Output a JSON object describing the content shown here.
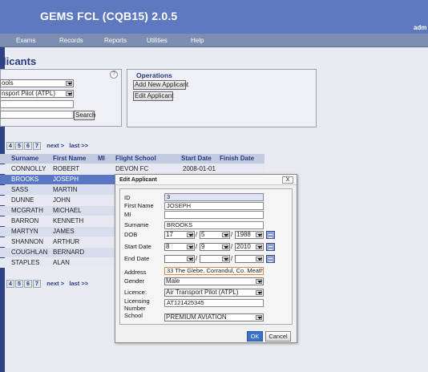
{
  "header": {
    "title": "GEMS FCL (CQB15) 2.0.5",
    "user": "adm"
  },
  "menu": [
    "Exams",
    "Records",
    "Reports",
    "Utilities",
    "Help"
  ],
  "page_title": "licants",
  "search": {
    "select1": "ools",
    "select2": "nsport Pilot (ATPL)",
    "text1": "",
    "text2": "",
    "button": "Search"
  },
  "operations": {
    "title": "Operations",
    "add": "Add New Applicant",
    "edit": "Edit Applicant"
  },
  "pager": {
    "pages": [
      "4",
      "5",
      "6",
      "7"
    ],
    "next": "next >",
    "last": "last >>"
  },
  "table": {
    "columns": [
      "Surname",
      "First Name",
      "MI",
      "Flight School",
      "Start Date",
      "Finish Date"
    ],
    "rows": [
      [
        "CONNOLLY",
        "ROBERT",
        "",
        "DEVON FC",
        "2008-01-01",
        ""
      ],
      [
        "BROOKS",
        "JOSEPH",
        "",
        "",
        "",
        ""
      ],
      [
        "SASS",
        "MARTIN",
        "",
        "",
        "",
        ""
      ],
      [
        "DUNNE",
        "JOHN",
        "",
        "",
        "",
        ""
      ],
      [
        "MCGRATH",
        "MICHAEL",
        "",
        "",
        "",
        ""
      ],
      [
        "BARRON",
        "KENNETH",
        "",
        "",
        "",
        ""
      ],
      [
        "MARTYN",
        "JAMES",
        "",
        "",
        "",
        ""
      ],
      [
        "SHANNON",
        "ARTHUR",
        "",
        "",
        "",
        ""
      ],
      [
        "COUGHLAN",
        "BERNARD",
        "",
        "",
        "",
        ""
      ],
      [
        "STAPLES",
        "ALAN",
        "",
        "",
        "",
        ""
      ]
    ],
    "selected_row": 1
  },
  "modal": {
    "title": "Edit Applicant",
    "close": "X",
    "labels": {
      "id": "ID",
      "first_name": "First Name",
      "mi": "MI",
      "surname": "Surname",
      "dob": "DOB",
      "start_date": "Start Date",
      "end_date": "End Date",
      "address": "Address",
      "gender": "Gender",
      "licence": "Licence:",
      "licensing_number_1": "Licensing",
      "licensing_number_2": "Number",
      "school": "School"
    },
    "values": {
      "id": "3",
      "first_name": "JOSEPH",
      "mi": "",
      "surname": "BROOKS",
      "dob_day": "17",
      "dob_month": "5",
      "dob_year": "1988",
      "start_day": "8",
      "start_month": "9",
      "start_year": "2010",
      "end_day": "",
      "end_month": "",
      "end_year": "",
      "address": "33 The Glebe, Corrandul, Co. Meath",
      "gender": "Male",
      "licence": "Air Transport Pilot (ATPL)",
      "licensing_number": "AT121425345",
      "school": "PREMIUM AVIATION"
    },
    "ok": "OK",
    "cancel": "Cancel"
  },
  "colors": {
    "header": "#5f79c0",
    "selected_row": "#5a77c5",
    "ok_button": "#3a72c9"
  }
}
